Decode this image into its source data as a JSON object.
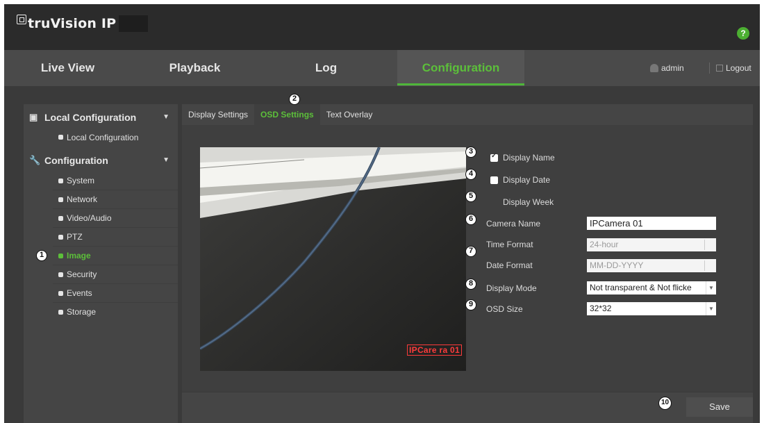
{
  "app": {
    "logo_text": "truVision IP",
    "help_label": "?"
  },
  "nav": {
    "tabs": [
      "Live View",
      "Playback",
      "Log",
      "Configuration"
    ],
    "active": "Configuration",
    "user": "admin",
    "logout": "Logout"
  },
  "sidebar": {
    "local_header": "Local Configuration",
    "local_items": [
      "Local Configuration"
    ],
    "config_header": "Configuration",
    "config_items": [
      "System",
      "Network",
      "Video/Audio",
      "PTZ",
      "Image",
      "Security",
      "Events",
      "Storage"
    ],
    "active_item": "Image"
  },
  "subtabs": [
    "Display Settings",
    "OSD Settings",
    "Text Overlay"
  ],
  "active_subtab": "OSD Settings",
  "preview": {
    "osd_text": "IPCare ra 01"
  },
  "form": {
    "display_name": {
      "label": "Display Name",
      "checked": true
    },
    "display_date": {
      "label": "Display Date",
      "checked": false
    },
    "display_week": {
      "label": "Display Week"
    },
    "camera_name": {
      "label": "Camera Name",
      "value": "IPCamera 01"
    },
    "time_format": {
      "label": "Time Format",
      "value": "24-hour"
    },
    "date_format": {
      "label": "Date Format",
      "value": "MM-DD-YYYY"
    },
    "display_mode": {
      "label": "Display Mode",
      "value": "Not transparent & Not flicke"
    },
    "osd_size": {
      "label": "OSD Size",
      "value": "32*32"
    }
  },
  "save_label": "Save",
  "callouts": [
    "1",
    "2",
    "3",
    "4",
    "5",
    "6",
    "7",
    "8",
    "9",
    "10"
  ],
  "colors": {
    "accent": "#5cbf3a",
    "background": "#3a3a3a",
    "panel": "#454545",
    "osd_red": "#ff3b3b"
  }
}
